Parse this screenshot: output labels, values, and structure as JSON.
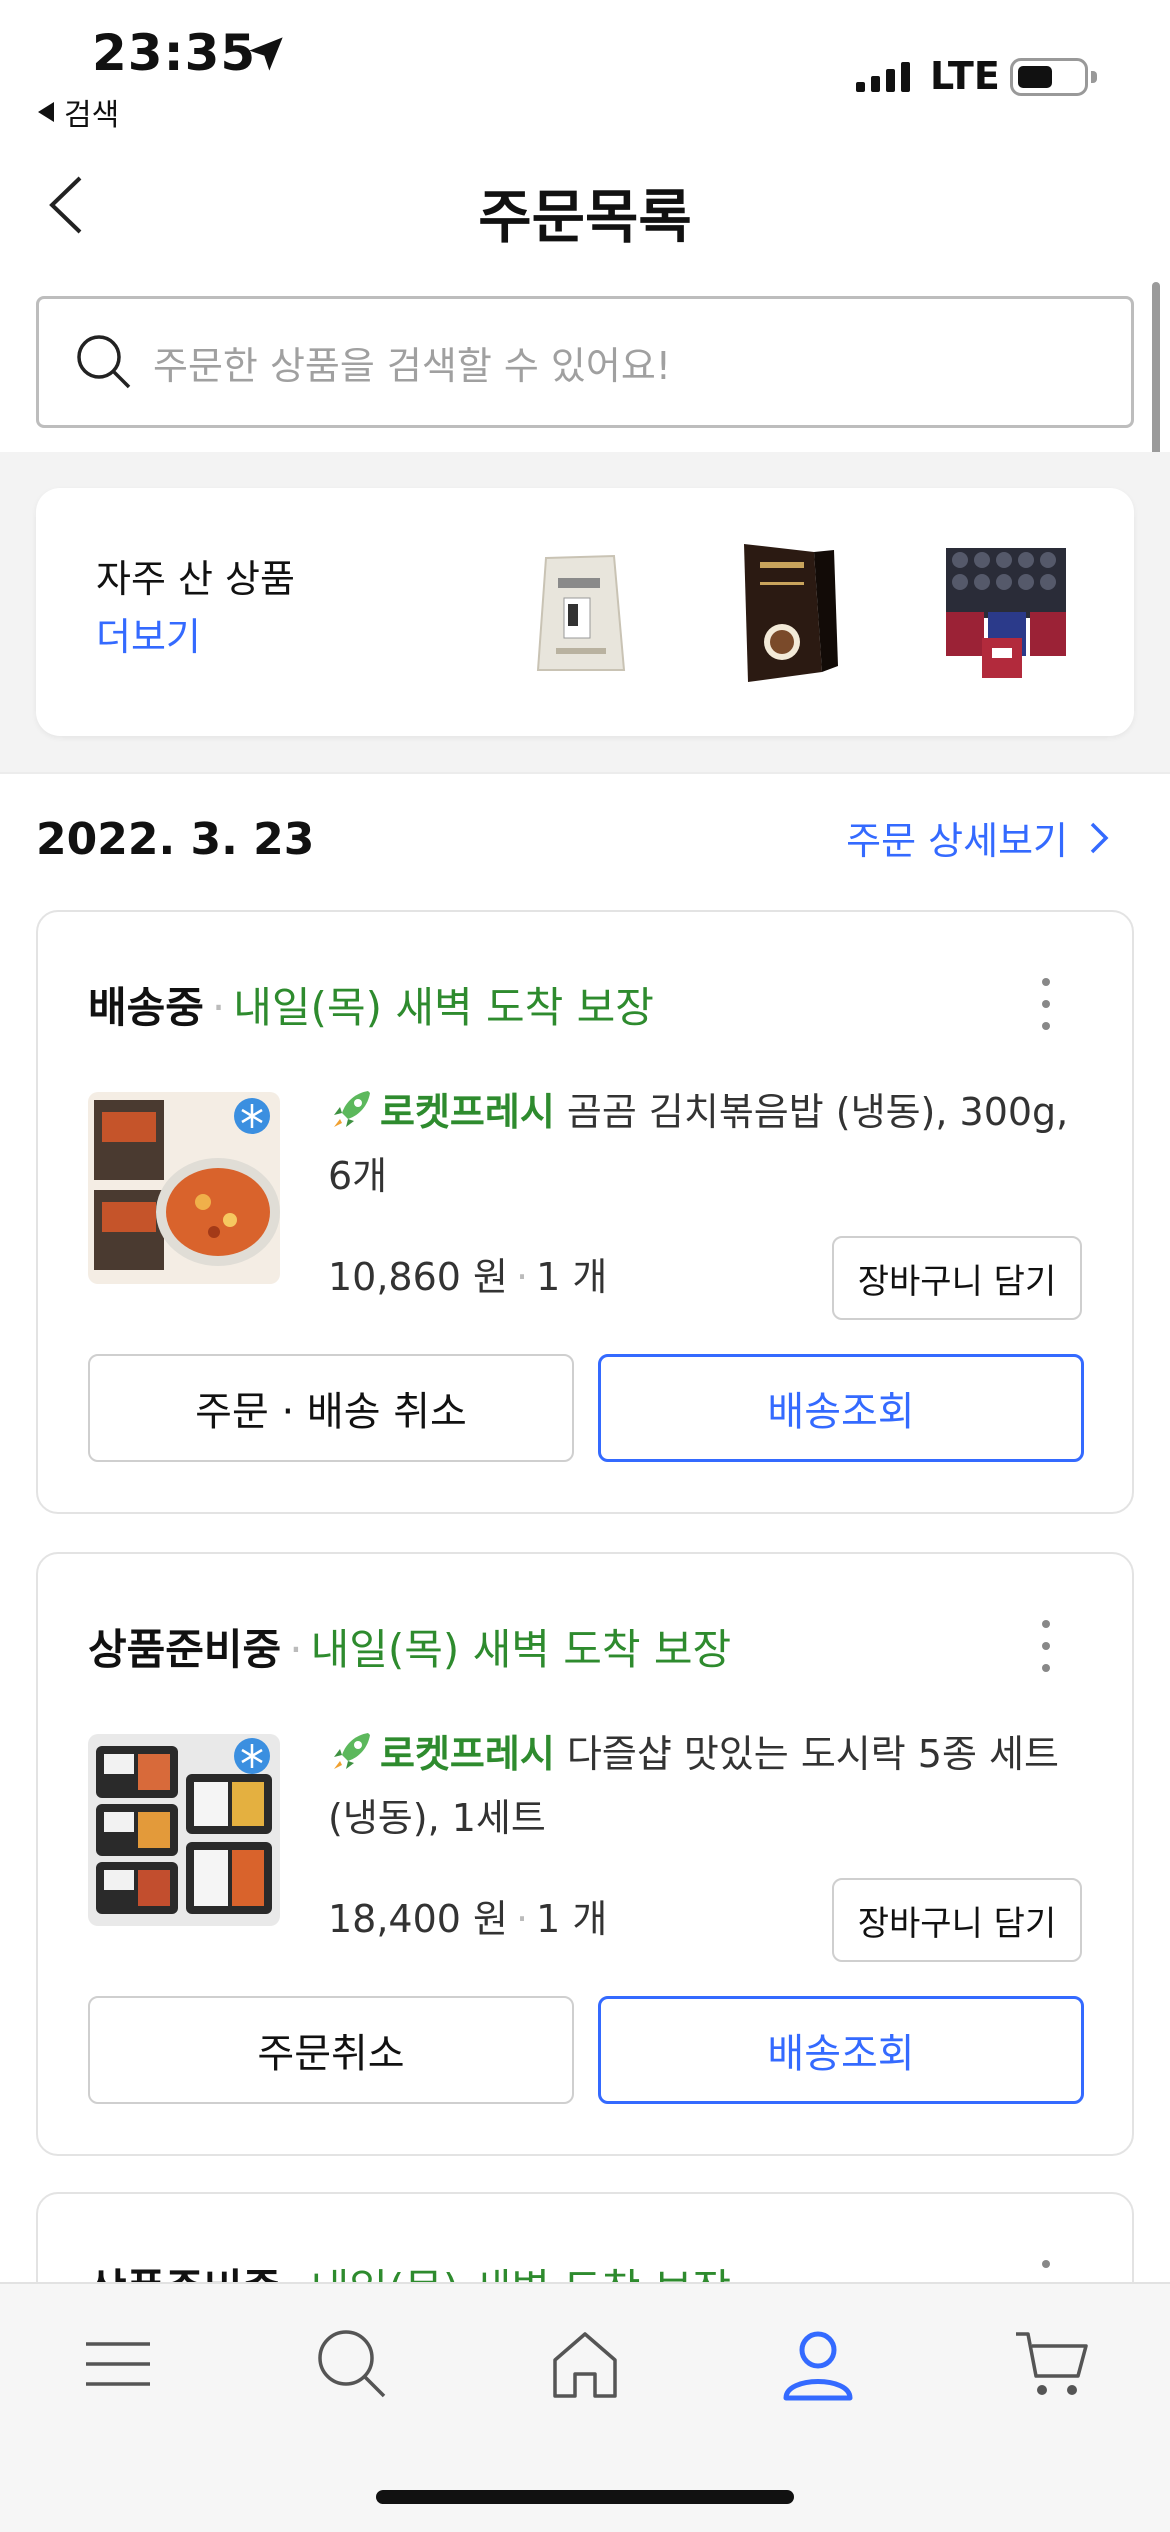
{
  "status_bar": {
    "time": "23:35",
    "back_app": "검색",
    "network": "LTE"
  },
  "header": {
    "title": "주문목록"
  },
  "search": {
    "placeholder": "주문한 상품을 검색할 수 있어요!"
  },
  "frequent": {
    "title": "자주 산 상품",
    "more_label": "더보기"
  },
  "order_group": {
    "date": "2022. 3. 23",
    "detail_link": "주문 상세보기"
  },
  "orders": [
    {
      "status": "배송중",
      "delivery": "내일(목) 새벽 도착 보장",
      "brand": "로켓프레시",
      "product": "곰곰 김치볶음밥 (냉동), 300g, 6개",
      "price": "10,860 원",
      "qty": "1 개",
      "cart_label": "장바구니 담기",
      "left_action": "주문 · 배송 취소",
      "right_action": "배송조회",
      "frozen_badge": "냉동"
    },
    {
      "status": "상품준비중",
      "delivery": "내일(목) 새벽 도착 보장",
      "brand": "로켓프레시",
      "product": "다즐샵 맛있는 도시락 5종 세트(냉동), 1세트",
      "price": "18,400 원",
      "qty": "1 개",
      "cart_label": "장바구니 담기",
      "left_action": "주문취소",
      "right_action": "배송조회",
      "frozen_badge": "냉동"
    },
    {
      "status": "상품준비중",
      "delivery": "내일(목) 새벽 도착 보장"
    }
  ],
  "tabbar": {
    "items": [
      "menu-icon",
      "search-icon",
      "home-icon",
      "my-icon",
      "cart-icon"
    ],
    "active": "my-icon"
  },
  "colors": {
    "accent": "#346aff",
    "green": "#2e8b2e"
  }
}
